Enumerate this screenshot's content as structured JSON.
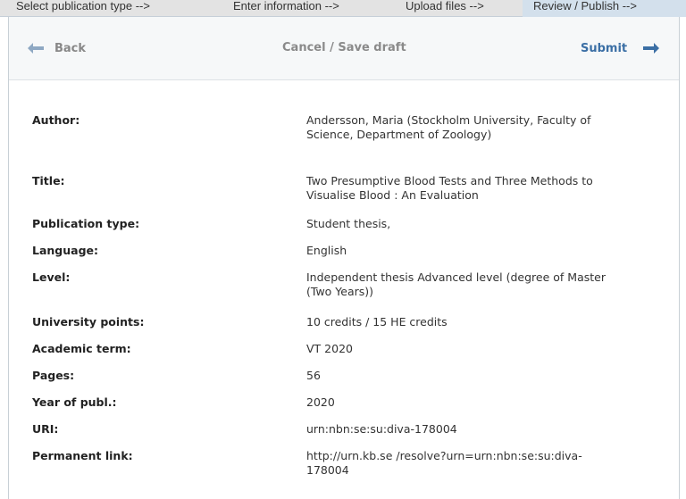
{
  "steps": [
    {
      "label": "Select publication type -->"
    },
    {
      "label": "Enter information -->"
    },
    {
      "label": "Upload files -->"
    },
    {
      "label": "Review / Publish -->"
    }
  ],
  "toolbar": {
    "back_label": "Back",
    "cancel_label": "Cancel / Save draft",
    "submit_label": "Submit",
    "colors": {
      "submit": "#3b6fa5",
      "arrow": "#8ea8c3"
    },
    "icons": {
      "back": "arrow-left-icon",
      "submit": "arrow-right-icon"
    }
  },
  "fields": [
    {
      "label": "Author:",
      "value": "Andersson, Maria (Stockholm University, Faculty of Science, Department of Zoology)"
    },
    {
      "label": "Title:",
      "value": "Two Presumptive Blood Tests and Three Methods to Visualise Blood : An Evaluation"
    },
    {
      "label": "Publication type:",
      "value": "Student thesis,"
    },
    {
      "label": "Language:",
      "value": "English"
    },
    {
      "label": "Level:",
      "value": "Independent thesis Advanced level (degree of Master (Two Years))"
    },
    {
      "label": "University points:",
      "value": "10 credits / 15 HE credits"
    },
    {
      "label": "Academic term:",
      "value": "VT 2020"
    },
    {
      "label": "Pages:",
      "value": "56"
    },
    {
      "label": "Year of publ.:",
      "value": "2020"
    },
    {
      "label": "URI:",
      "value": "urn:nbn:se:su:diva-178004"
    },
    {
      "label": "Permanent link:",
      "value": "http://urn.kb.se /resolve?urn=urn:nbn:se:su:diva-178004"
    }
  ]
}
